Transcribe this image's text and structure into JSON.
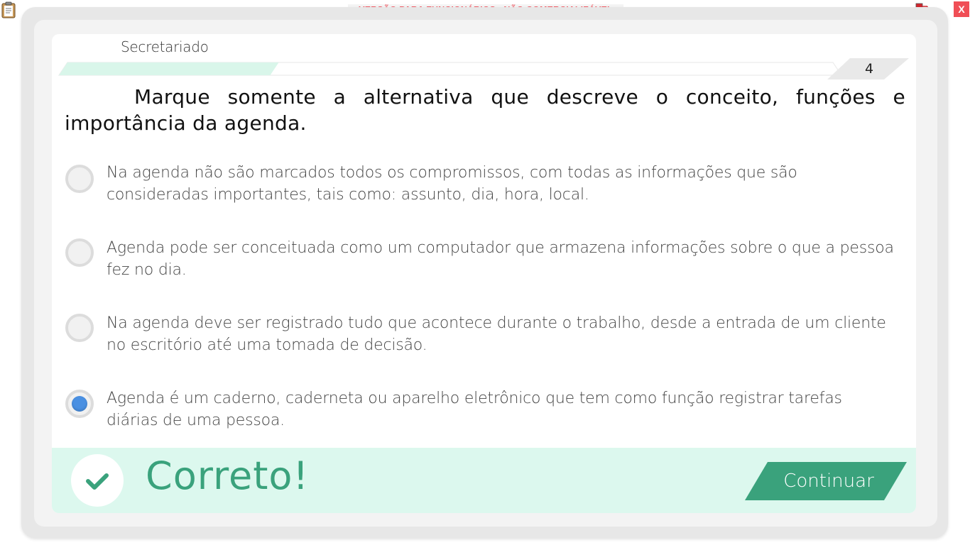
{
  "watermark": "VERSÃO PARA FUNCIONÁRIOS - NÃO COMERCIALIZÁVEL",
  "close_label": "X",
  "subject": "Secretariado",
  "page_number": "4",
  "progress": 0.27,
  "question": "Marque somente a alternativa que descreve o conceito, funções e importância da agenda.",
  "options": [
    {
      "text": "Na agenda não são marcados todos os compromissos, com todas as informações que são consideradas importantes, tais como: assunto, dia, hora, local.",
      "selected": false
    },
    {
      "text": "Agenda pode ser conceituada como  um computador que armazena informações sobre o que a pessoa fez no dia.",
      "selected": false
    },
    {
      "text": "Na agenda deve ser registrado tudo que acontece durante o trabalho, desde a entrada de um cliente no escritório até uma tomada de decisão.",
      "selected": false
    },
    {
      "text": "Agenda é um caderno, caderneta ou aparelho eletrônico que tem como função registrar tarefas diárias de uma pessoa.",
      "selected": true
    }
  ],
  "feedback": {
    "result": "Correto!",
    "continue_label": "Continuar"
  },
  "colors": {
    "accent_green": "#3aa27c",
    "feedback_bg": "#dcf8ee",
    "progress_fill": "#d9f6ea",
    "radio_selected": "#4a90e2",
    "watermark": "#ef5a64",
    "close_bg": "#f04e56"
  },
  "icons": [
    "clipboard-icon",
    "network-status-icon",
    "check-icon"
  ]
}
